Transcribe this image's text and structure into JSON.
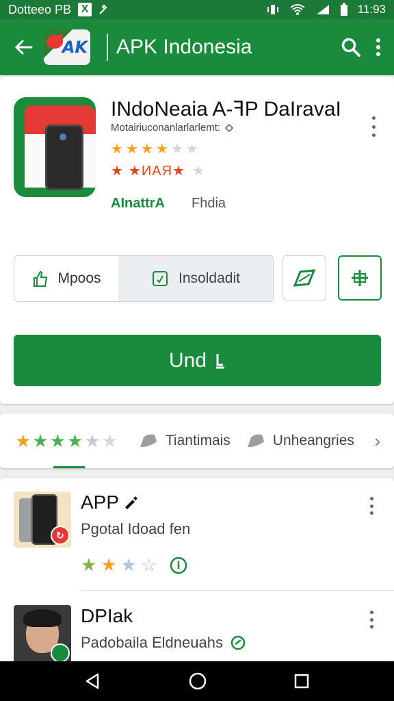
{
  "status_bar": {
    "carrier": "Dotteeo PB",
    "box_glyph": "X",
    "time": "11:93"
  },
  "app_bar": {
    "logo_text": "AK",
    "title": "APK Indonesia"
  },
  "app": {
    "name": "INdoNeaia A-ꟻP DaIravaI",
    "developer_line": "Motairiuconanlarlarlemt:",
    "rating_text": "★ Ṅ Ḫ R ★",
    "rating_word": "★ИАЯ★",
    "dev_link": "AInattrA",
    "dev_region": "Fhdia",
    "btn_a": "Mpoos",
    "btn_b": "Insoldadit",
    "install_label": "Und"
  },
  "rating_bar": {
    "item1": "Tiantimais",
    "item2": "Unheangries"
  },
  "list": [
    {
      "title": "APP",
      "subtitle": "Pgotal Idoad fen"
    },
    {
      "title": "DPIak",
      "subtitle": "Padobaila Eldneuahs"
    }
  ],
  "colors": {
    "primary": "#1a8a3c",
    "status_bar": "#1b7a37",
    "star": "#f4a023",
    "accent_red": "#e53935"
  },
  "icons": [
    "back-arrow-icon",
    "search-icon",
    "more-vert-icon",
    "share-icon",
    "add-icon",
    "install-icon",
    "wishlist-icon",
    "chevron-right-icon",
    "back-nav-icon",
    "home-nav-icon",
    "recents-nav-icon"
  ]
}
